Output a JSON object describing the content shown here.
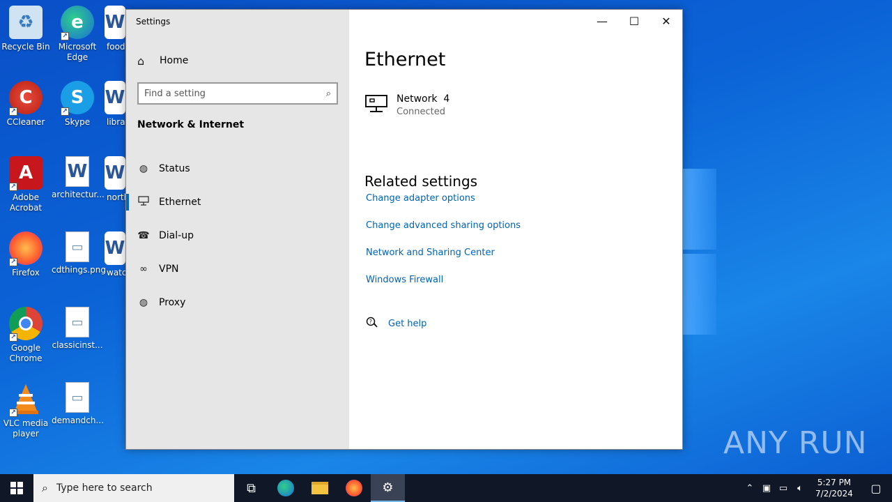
{
  "desktop": {
    "icons": [
      {
        "label": "Recycle Bin"
      },
      {
        "label": "Microsoft Edge"
      },
      {
        "label": "food"
      },
      {
        "label": "CCleaner"
      },
      {
        "label": "Skype"
      },
      {
        "label": "librar"
      },
      {
        "label": "Adobe Acrobat"
      },
      {
        "label": "architectur..."
      },
      {
        "label": "north"
      },
      {
        "label": "Firefox"
      },
      {
        "label": "cdthings.png"
      },
      {
        "label": "watc"
      },
      {
        "label": "Google Chrome"
      },
      {
        "label": "classicinst..."
      },
      {
        "label": "VLC media player"
      },
      {
        "label": "demandch..."
      }
    ],
    "watermark": "ANY RUN"
  },
  "window": {
    "title": "Settings",
    "controls": {
      "minimize": "—",
      "maximize": "☐",
      "close": "✕"
    }
  },
  "sidebar": {
    "home_label": "Home",
    "search_placeholder": "Find a setting",
    "section_title": "Network & Internet",
    "items": [
      {
        "label": "Status",
        "icon": "globe-icon",
        "active": false
      },
      {
        "label": "Ethernet",
        "icon": "ethernet-icon",
        "active": true
      },
      {
        "label": "Dial-up",
        "icon": "dialup-icon",
        "active": false
      },
      {
        "label": "VPN",
        "icon": "vpn-icon",
        "active": false
      },
      {
        "label": "Proxy",
        "icon": "globe-icon",
        "active": false
      }
    ]
  },
  "main": {
    "title": "Ethernet",
    "network": {
      "name": "Network  4",
      "status": "Connected"
    },
    "related_title": "Related settings",
    "links": [
      "Change adapter options",
      "Change advanced sharing options",
      "Network and Sharing Center",
      "Windows Firewall"
    ],
    "help_label": "Get help"
  },
  "taskbar": {
    "search_placeholder": "Type here to search",
    "time": "5:27 PM",
    "date": "7/2/2024"
  },
  "colors": {
    "accent": "#0067c0",
    "link": "#0063b1",
    "sidebar_bg": "#e6e6e6"
  }
}
